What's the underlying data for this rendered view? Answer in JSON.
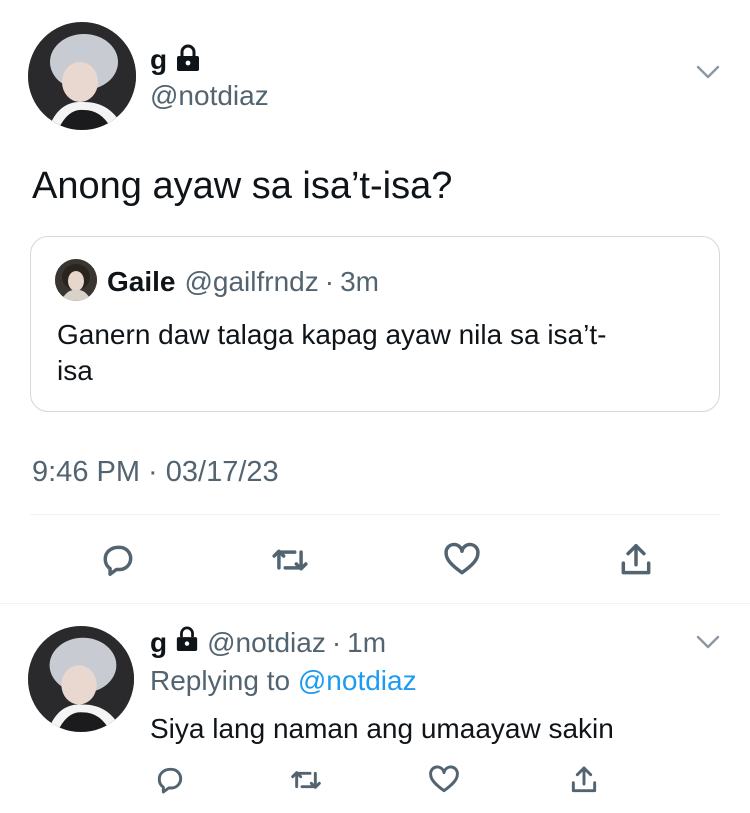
{
  "tweet": {
    "display_name": "g",
    "handle": "@notdiaz",
    "text": "Anong ayaw sa isa’t-isa?",
    "timestamp": "9:46 PM · 03/17/23"
  },
  "quote": {
    "display_name": "Gaile",
    "handle": "@gailfrndz",
    "sep": "·",
    "time": "3m",
    "text_line1": "Ganern daw talaga kapag ayaw nila sa isa’t-",
    "text_line2": "isa"
  },
  "reply": {
    "display_name": "g",
    "handle": "@notdiaz",
    "sep": "·",
    "time": "1m",
    "replying_label": "Replying to",
    "replying_handle": "@notdiaz",
    "text": "Siya lang naman ang umaayaw sakin"
  },
  "icons": {
    "reply": "reply-icon",
    "retweet": "retweet-icon",
    "like": "heart-icon",
    "share": "share-icon",
    "lock": "lock-icon",
    "more": "chevron-down-icon"
  },
  "colors": {
    "text": "#0f1419",
    "secondary": "#536471",
    "link": "#1d9bf0",
    "border": "#cfd9de"
  }
}
